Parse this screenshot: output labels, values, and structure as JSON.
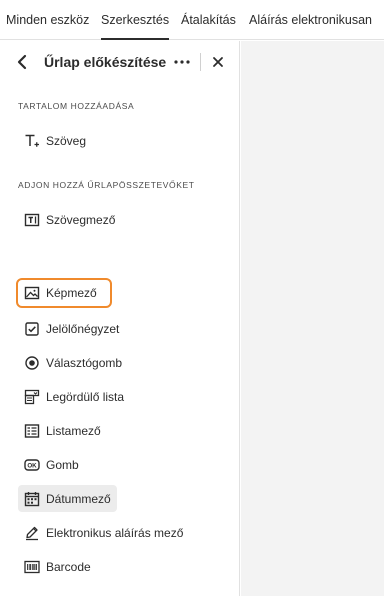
{
  "topnav": {
    "tabs": [
      {
        "label": "Minden eszköz"
      },
      {
        "label": "Szerkesztés",
        "active": true
      },
      {
        "label": "Átalakítás"
      },
      {
        "label": "Aláírás elektronikusan"
      }
    ]
  },
  "panel": {
    "title": "Űrlap előkészítése",
    "sections": {
      "add_content": {
        "label": "TARTALOM HOZZÁADÁSA",
        "items": [
          {
            "label": "Szöveg",
            "icon": "add-text-icon"
          }
        ]
      },
      "form_fields": {
        "label": "ADJON HOZZÁ ŰRLAPÖSSZETEVŐKET",
        "items": [
          {
            "label": "Szövegmező",
            "icon": "text-field-icon"
          },
          {
            "label": "Képmező",
            "icon": "image-field-icon",
            "highlighted": true
          },
          {
            "label": "Jelölőnégyzet",
            "icon": "checkbox-icon"
          },
          {
            "label": "Választógomb",
            "icon": "radio-button-icon"
          },
          {
            "label": "Legördülő lista",
            "icon": "dropdown-list-icon"
          },
          {
            "label": "Listamező",
            "icon": "list-box-icon"
          },
          {
            "label": "Gomb",
            "icon": "button-ok-icon"
          },
          {
            "label": "Dátummező",
            "icon": "date-field-icon",
            "selected": true
          },
          {
            "label": "Elektronikus aláírás mező",
            "icon": "e-signature-icon"
          },
          {
            "label": "Barcode",
            "icon": "barcode-icon"
          }
        ]
      }
    }
  },
  "colors": {
    "highlight_outline": "#f08a2c",
    "selected_bg": "#ececec",
    "canvas_bg": "#f3f3f3"
  }
}
